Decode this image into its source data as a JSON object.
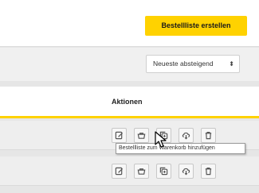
{
  "header": {
    "create_button_label": "Bestellliste erstellen"
  },
  "sort": {
    "selected_label": "Neueste absteigend",
    "chevron": "⬍"
  },
  "table": {
    "actions_header": "Aktionen",
    "rows": [
      {
        "actions": [
          "edit-icon",
          "basket-icon",
          "copy-icon",
          "download-icon",
          "delete-icon"
        ]
      },
      {
        "actions": [
          "edit-icon",
          "basket-icon",
          "copy-icon",
          "download-icon",
          "delete-icon"
        ]
      }
    ]
  },
  "tooltip": {
    "text": "Bestellliste zum Warenkorb hinzufügen"
  },
  "colors": {
    "accent": "#ffd200",
    "background": "#e6e6e6"
  }
}
